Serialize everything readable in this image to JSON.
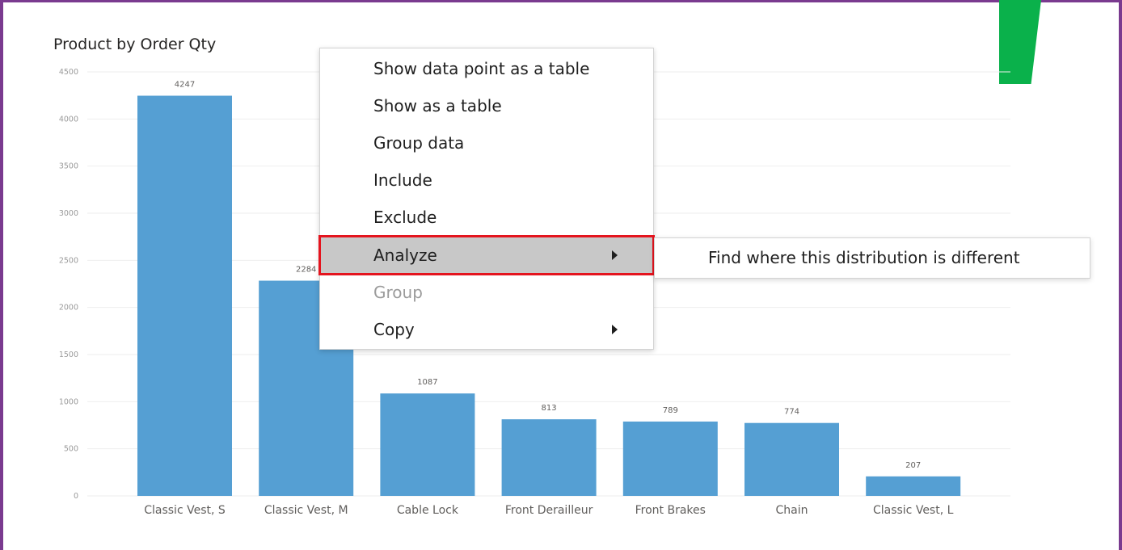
{
  "chart_title": "Product by Order Qty",
  "context_menu": {
    "items": [
      {
        "label": "Show data point as a table"
      },
      {
        "label": "Show as a table"
      },
      {
        "label": "Group data"
      },
      {
        "label": "Include"
      },
      {
        "label": "Exclude"
      },
      {
        "label": "Analyze",
        "highlighted": true,
        "has_submenu": true
      },
      {
        "label": "Group",
        "disabled": true
      },
      {
        "label": "Copy",
        "has_submenu": true
      }
    ],
    "submenu": {
      "items": [
        {
          "label": "Find where this distribution is different"
        }
      ]
    }
  },
  "chart_data": {
    "type": "bar",
    "categories": [
      "Classic Vest, S",
      "Classic Vest, M",
      "Cable Lock",
      "Front Derailleur",
      "Front Brakes",
      "Chain",
      "Classic Vest, L"
    ],
    "values": [
      4247,
      2284,
      1087,
      813,
      789,
      774,
      207
    ],
    "title": "Product by Order Qty",
    "xlabel": "",
    "ylabel": "",
    "ylim": [
      0,
      4500
    ],
    "yticks": [
      0,
      500,
      1000,
      1500,
      2000,
      2500,
      3000,
      3500,
      4000,
      4500
    ],
    "grid": true,
    "bar_color": "#559fd3"
  },
  "colors": {
    "frame": "#7a3a8f",
    "highlight_outline": "#e4141e",
    "highlight_bg": "#c8c8c8",
    "green_decoration": "#0ab14b"
  }
}
